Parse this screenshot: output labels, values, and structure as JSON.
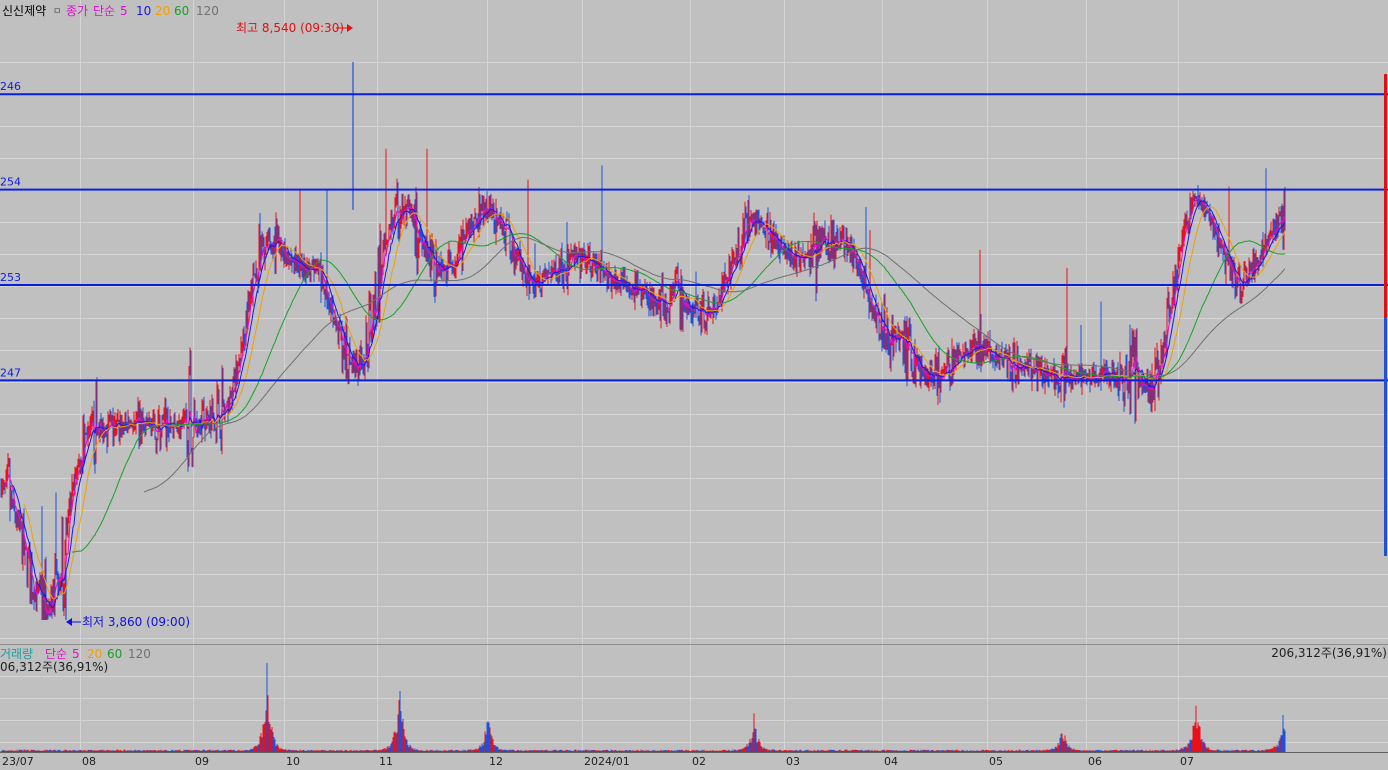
{
  "colors": {
    "background": "#c0c0c0",
    "grid": "#d4d4d4",
    "up": "#e8101a",
    "down": "#2050d8",
    "ma5": "#e010d0",
    "ma10": "#1a1ae0",
    "ma20": "#f0a000",
    "ma60": "#18a028",
    "ma120": "#707070",
    "hline": "#0a1ee0",
    "high_marker": "#e01010",
    "low_marker": "#1010e0"
  },
  "header": {
    "stock_name": "신신제약",
    "box_symbol": "ㅁ",
    "close_label": "종가",
    "ma_type": "단순",
    "ma_periods": [
      "5",
      "10",
      "20",
      "60",
      "120"
    ]
  },
  "volume_header": {
    "label": "거래량",
    "ma_type": "단순",
    "ma_periods": [
      "5",
      "20",
      "60",
      "120"
    ],
    "value_left": "06,312주(36,91%)",
    "value_right": "206,312주(36,91%)"
  },
  "annotations": {
    "high": "최고 8,540 (09:30)",
    "low": "최저 3,860 (09:00)"
  },
  "hlines": [
    {
      "label": "246",
      "price": 8270
    },
    {
      "label": "254",
      "price": 7470
    },
    {
      "label": "253",
      "price": 6670
    },
    {
      "label": "247",
      "price": 5870
    }
  ],
  "x_axis": {
    "labels": [
      "23/07",
      "08",
      "09",
      "10",
      "11",
      "12",
      "2024/01",
      "02",
      "03",
      "04",
      "05",
      "06",
      "07"
    ]
  },
  "chart_data": {
    "type": "candlestick",
    "title": "신신제약",
    "price_range": [
      3860,
      8540
    ],
    "high": {
      "value": 8540,
      "time": "09:30",
      "month": "10"
    },
    "low": {
      "value": 3860,
      "time": "09:00",
      "month": "08"
    },
    "approx_close_path": [
      {
        "month": "23/07",
        "price": 4950
      },
      {
        "month": "07 late",
        "price": 3950
      },
      {
        "month": "08",
        "price": 5450
      },
      {
        "month": "08 mid",
        "price": 5500
      },
      {
        "month": "09",
        "price": 5480
      },
      {
        "month": "09 mid",
        "price": 5600
      },
      {
        "month": "09 late",
        "price": 7000
      },
      {
        "month": "10",
        "price": 6800
      },
      {
        "month": "10 mid",
        "price": 6000
      },
      {
        "month": "10 late",
        "price": 7300
      },
      {
        "month": "11",
        "price": 6800
      },
      {
        "month": "11 mid",
        "price": 7300
      },
      {
        "month": "12",
        "price": 6700
      },
      {
        "month": "12 mid",
        "price": 6900
      },
      {
        "month": "2024/01",
        "price": 6700
      },
      {
        "month": "01 mid",
        "price": 6500
      },
      {
        "month": "02",
        "price": 6450
      },
      {
        "month": "02 mid",
        "price": 7200
      },
      {
        "month": "03",
        "price": 6900
      },
      {
        "month": "03 mid",
        "price": 7050
      },
      {
        "month": "04",
        "price": 6300
      },
      {
        "month": "04 mid",
        "price": 5900
      },
      {
        "month": "05",
        "price": 6150
      },
      {
        "month": "05 mid",
        "price": 6000
      },
      {
        "month": "06",
        "price": 5880
      },
      {
        "month": "06 mid",
        "price": 5900
      },
      {
        "month": "07",
        "price": 5820
      },
      {
        "month": "07 mid",
        "price": 7400
      },
      {
        "month": "07 late",
        "price": 6700
      },
      {
        "month": "07 end",
        "price": 7200
      }
    ],
    "volume_spikes": [
      {
        "month": "09 late",
        "volume": 3.0
      },
      {
        "month": "10 late",
        "volume": 2.6
      },
      {
        "month": "11 mid",
        "volume": 1.4
      },
      {
        "month": "02 mid",
        "volume": 1.3
      },
      {
        "month": "06",
        "volume": 0.9
      },
      {
        "month": "07 mid",
        "volume": 2.2
      },
      {
        "month": "07 end",
        "volume": 1.6
      }
    ],
    "grid": true,
    "legend_position": "top-left"
  }
}
